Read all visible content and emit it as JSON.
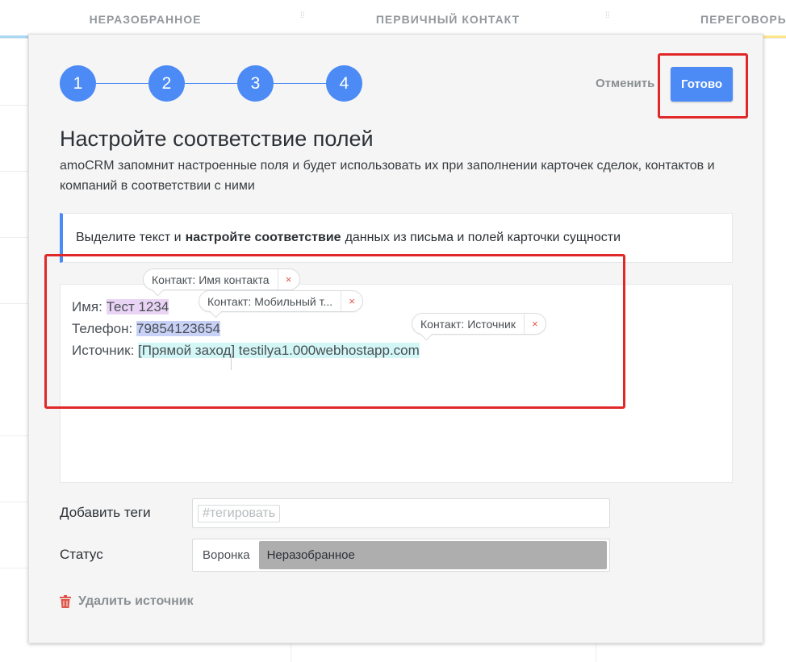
{
  "background": {
    "columns": [
      "НЕРАЗОБРАННОЕ",
      "ПЕРВИЧНЫЙ КОНТАКТ",
      "ПЕРЕГОВОРЫ"
    ],
    "column_colors": [
      "#a9d9f2",
      "#ffe79a",
      "#ffe58a"
    ]
  },
  "steps": [
    "1",
    "2",
    "3",
    "4"
  ],
  "actions": {
    "cancel_label": "Отменить",
    "done_label": "Готово"
  },
  "header": {
    "title": "Настройте соответствие полей",
    "subtitle": "amoCRM запомнит настроенные поля и будет использовать их при заполнении карточек сделок, контактов и компаний в соответствии с ними"
  },
  "hint": {
    "before": "Выделите текст и",
    "bold": "настройте соответствие",
    "after": "данных из письма и полей карточки сущности"
  },
  "mail": {
    "lines": [
      {
        "label": "Имя:",
        "value": "Тест 1234"
      },
      {
        "label": "Телефон:",
        "value": "79854123654"
      },
      {
        "label": "Источник:",
        "value": "[Прямой заход] testilya1.000webhostapp.com"
      }
    ]
  },
  "field_tags": [
    {
      "label": "Контакт: Имя контакта",
      "remove": "×"
    },
    {
      "label": "Контакт: Мобильный т...",
      "remove": "×"
    },
    {
      "label": "Контакт: Источник",
      "remove": "×"
    }
  ],
  "tags_row": {
    "label": "Добавить теги",
    "placeholder": "#тегировать"
  },
  "status_row": {
    "label": "Статус",
    "funnel": "Воронка",
    "stage": "Неразобранное"
  },
  "delete_label": "Удалить источник",
  "colors": {
    "accent": "#4c8bf5",
    "highlight_red": "#e02828",
    "name_highlight": "#e9d4f5",
    "phone_highlight": "#c8d2f7",
    "source_highlight": "#d3f6f6",
    "trash": "#e0564b"
  }
}
